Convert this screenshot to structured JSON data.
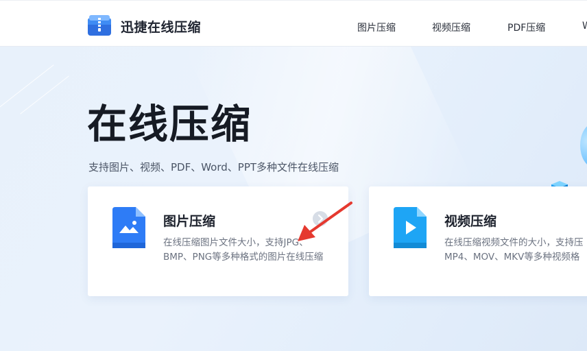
{
  "header": {
    "brand": "迅捷在线压缩",
    "nav": [
      {
        "label": "图片压缩"
      },
      {
        "label": "视频压缩"
      },
      {
        "label": "PDF压缩"
      },
      {
        "label": "W"
      }
    ]
  },
  "hero": {
    "title": "在线压缩",
    "subtitle": "支持图片、视频、PDF、Word、PPT多种文件在线压缩"
  },
  "cards": [
    {
      "title": "图片压缩",
      "desc": "在线压缩图片文件大小，支持JPG、BMP、PNG等多种格式的图片在线压缩",
      "icon": "image-file-icon"
    },
    {
      "title": "视频压缩",
      "desc_line1": "在线压缩视频文件的大小，支持压",
      "desc_line2": "MP4、MOV、MKV等多种视频格",
      "icon": "video-file-icon"
    }
  ],
  "colors": {
    "accent_blue": "#2e7cf6",
    "video_blue": "#1ea5f5",
    "arrow_red": "#e5392f"
  }
}
